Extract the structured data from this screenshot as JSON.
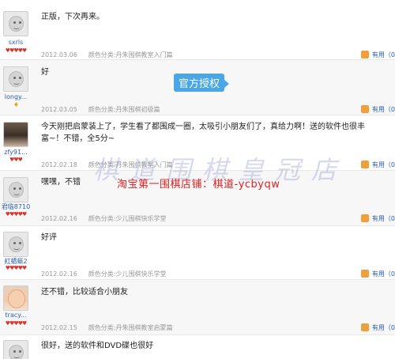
{
  "watermark": {
    "badge": "官方授权",
    "shop_line": "淘宝第一围棋店铺：棋道-ycbyqw",
    "big": "棋道围棋皇冠店"
  },
  "useful_label": "有用（0",
  "reviews": [
    {
      "username": "sxrls",
      "rank": "♥♥♥♥♥",
      "text": "正版，下次再来。",
      "date": "2012.03.06",
      "category": "颜色分类:丹朱围棋教室入门篇"
    },
    {
      "username": "longy...",
      "rank": "♦",
      "text": "好",
      "date": "2012.03.05",
      "category": "颜色分类:丹朱围棋初级篇"
    },
    {
      "username": "zfy91...",
      "rank": "♥♥♥",
      "text": "今天刚把启蒙装上了，学生看了都围成一圈，太吸引小朋友们了，真给力啊！送的软件也很丰富~！不错，全5分~",
      "date": "2012.02.18",
      "category": "颜色分类:丹朱围棋教室入门篇"
    },
    {
      "username": "君临8710",
      "rank": "♥♥♥♥♥",
      "text": "嘿嘿，不错",
      "date": "2012.02.16",
      "category": "颜色分类:少儿围棋快乐学堂"
    },
    {
      "username": "紅蜻蜓2",
      "rank": "♥♥♥♥♥",
      "text": "好评",
      "date": "2012.02.16",
      "category": "颜色分类:少儿围棋快乐学堂"
    },
    {
      "username": "tracy...",
      "rank": "♥♥♥♥♥",
      "text": "还不错，比较适合小朋友",
      "date": "2012.02.15",
      "category": "颜色分类:丹朱围棋教室启蒙篇"
    },
    {
      "username": "",
      "rank": "",
      "text": "很好，送的软件和DVD碟也很好",
      "date": "",
      "category": ""
    }
  ]
}
